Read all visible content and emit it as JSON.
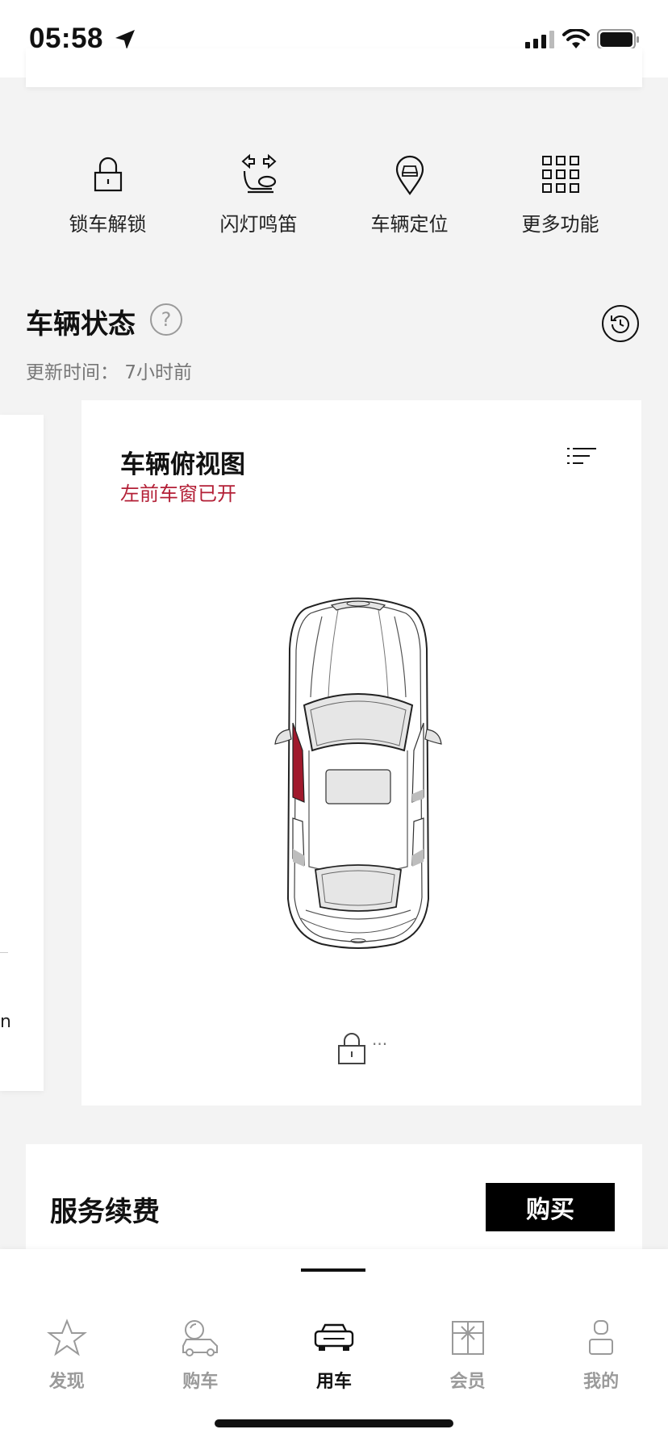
{
  "status_bar": {
    "time": "05:58",
    "icons": [
      "location-arrow-icon",
      "signal-icon",
      "wifi-icon",
      "battery-icon"
    ]
  },
  "quick_actions": [
    {
      "label": "锁车解锁",
      "icon": "lock-icon"
    },
    {
      "label": "闪灯鸣笛",
      "icon": "flash-horn-icon"
    },
    {
      "label": "车辆定位",
      "icon": "car-location-icon"
    },
    {
      "label": "更多功能",
      "icon": "grid-icon"
    }
  ],
  "vehicle_status": {
    "title": "车辆状态",
    "help": "?",
    "update_label": "更新时间：",
    "update_value": "7小时前"
  },
  "peek_card": {
    "text": "n"
  },
  "vehicle_card": {
    "title": "车辆俯视图",
    "alert": "左前车窗已开",
    "lock_suffix": "···",
    "alert_color": "#b31f36"
  },
  "service": {
    "title": "服务续费",
    "button": "购买"
  },
  "bottom_nav": [
    {
      "label": "发现",
      "icon": "star-icon",
      "active": false
    },
    {
      "label": "购车",
      "icon": "car-search-icon",
      "active": false
    },
    {
      "label": "用车",
      "icon": "car-icon",
      "active": true
    },
    {
      "label": "会员",
      "icon": "gift-icon",
      "active": false
    },
    {
      "label": "我的",
      "icon": "profile-icon",
      "active": false
    }
  ]
}
